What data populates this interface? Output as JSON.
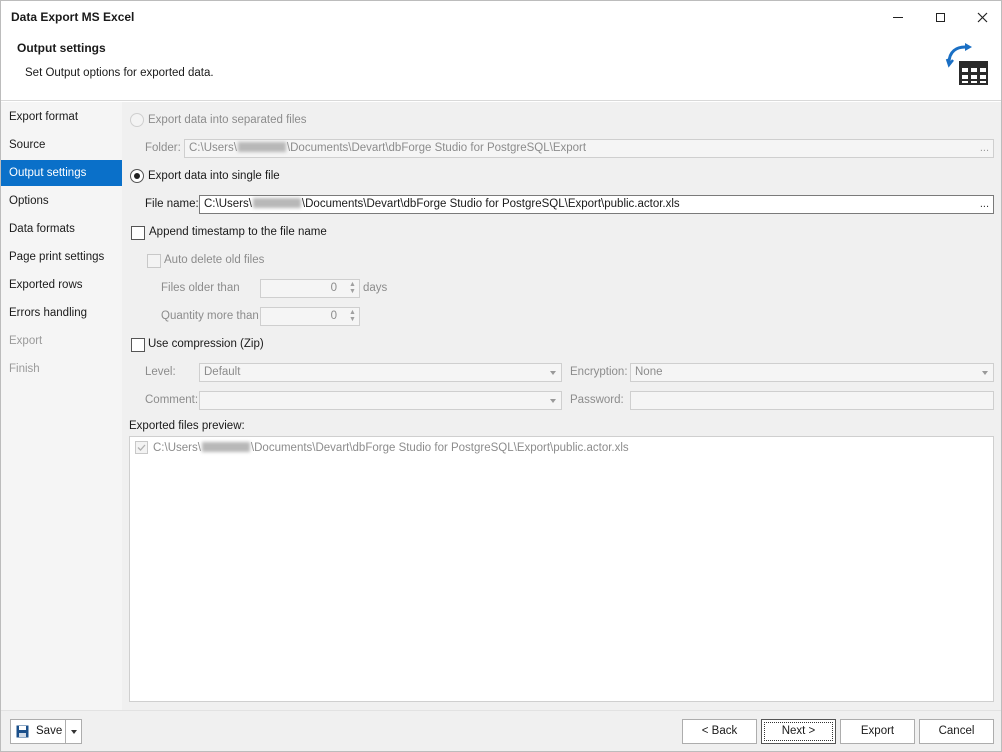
{
  "window": {
    "title": "Data Export MS Excel"
  },
  "header": {
    "title": "Output settings",
    "description": "Set Output options for exported data."
  },
  "sidebar": {
    "items": [
      {
        "label": "Export format",
        "state": "normal"
      },
      {
        "label": "Source",
        "state": "normal"
      },
      {
        "label": "Output settings",
        "state": "selected"
      },
      {
        "label": "Options",
        "state": "normal"
      },
      {
        "label": "Data formats",
        "state": "normal"
      },
      {
        "label": "Page print settings",
        "state": "normal"
      },
      {
        "label": "Exported rows",
        "state": "normal"
      },
      {
        "label": "Errors handling",
        "state": "normal"
      },
      {
        "label": "Export",
        "state": "disabled"
      },
      {
        "label": "Finish",
        "state": "disabled"
      }
    ]
  },
  "output": {
    "separate_files_label": "Export data into separated files",
    "folder_label": "Folder:",
    "folder_prefix": "C:\\Users\\",
    "folder_suffix": "\\Documents\\Devart\\dbForge Studio for PostgreSQL\\Export",
    "single_file_label": "Export data into single file",
    "file_name_label": "File name:",
    "file_prefix": "C:\\Users\\",
    "file_suffix": "\\Documents\\Devart\\dbForge Studio for PostgreSQL\\Export\\public.actor.xls",
    "browse_label": "...",
    "append_timestamp_label": "Append timestamp to the file name",
    "auto_delete_label": "Auto delete old files",
    "files_older_label": "Files older than",
    "files_older_value": "0",
    "days_label": "days",
    "quantity_label": "Quantity more than",
    "quantity_value": "0",
    "compression_label": "Use compression (Zip)",
    "level_label": "Level:",
    "level_value": "Default",
    "encryption_label": "Encryption:",
    "encryption_value": "None",
    "comment_label": "Comment:",
    "comment_value": "",
    "password_label": "Password:",
    "password_value": "",
    "preview_label": "Exported files preview:",
    "preview_prefix": "C:\\Users\\",
    "preview_suffix": "\\Documents\\Devart\\dbForge Studio for PostgreSQL\\Export\\public.actor.xls",
    "spin_up": "▲",
    "spin_down": "▼"
  },
  "footer": {
    "save_label": "Save",
    "back_label": "< Back",
    "next_label": "Next >",
    "export_label": "Export",
    "cancel_label": "Cancel"
  },
  "colors": {
    "accent": "#0a70c9",
    "icon_blue": "#1a6fc4",
    "icon_dark": "#2a2a2a"
  }
}
